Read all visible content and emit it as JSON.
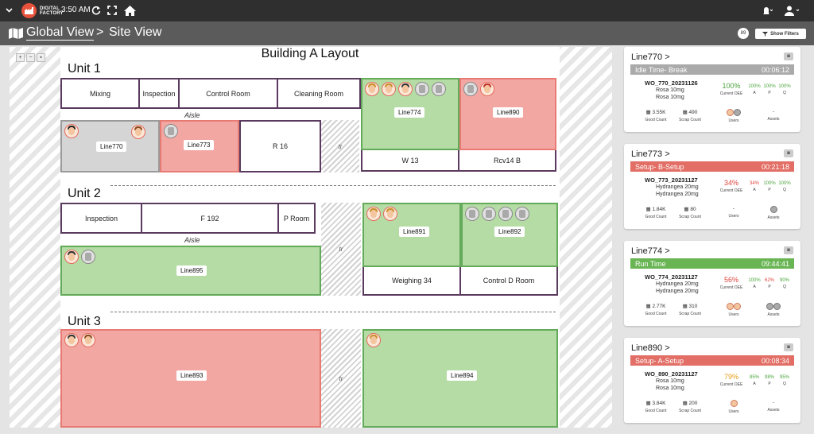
{
  "topbar": {
    "logo_line1": "DIGITAL",
    "logo_line2": "FACTORY",
    "time": "3:50 AM",
    "icons": [
      "chevron-down-icon",
      "refresh-icon",
      "expand-icon",
      "home-icon",
      "bell-icon",
      "user-icon"
    ]
  },
  "titlebar": {
    "crumb1": "Global View",
    "separator": ">",
    "crumb2": "Site View",
    "badge": "89",
    "filters": "Show Filters"
  },
  "layout": {
    "title": "Building A Layout",
    "units": [
      "Unit 1",
      "Unit 2",
      "Unit 3"
    ],
    "aisle": "Aisle",
    "tr": "tr",
    "rooms": {
      "mixing": "Mixing",
      "inspection1": "Inspection",
      "control_room": "Control Room",
      "cleaning_room": "Cleaning Room",
      "r16": "R 16",
      "w13": "W 13",
      "rcv14b": "Rcv14 B",
      "inspection2": "Inspection",
      "f192": "F 192",
      "p_room": "P Room",
      "weighing34": "Weighing 34",
      "control_d_room": "Control D Room"
    },
    "lines": {
      "l770": "Line770",
      "l773": "Line773",
      "l774": "Line774",
      "l890": "Line890",
      "l891": "Line891",
      "l892": "Line892",
      "l895": "Line895",
      "l893": "Line893",
      "l894": "Line894"
    }
  },
  "cards": [
    {
      "name": "Line770",
      "state": "Idle Time- Break",
      "timer": "00:06:12",
      "wo": "WO_770_20231126",
      "product1": "Rosa 10mg",
      "product2": "Rosa 10mg",
      "oee": "100%",
      "oee_label": "Current OEE",
      "a": "100%",
      "p": "100%",
      "q": "100%",
      "good": "3.55K",
      "scrap": "490",
      "assets": "-"
    },
    {
      "name": "Line773",
      "state": "Setup- B-Setup",
      "timer": "00:21:18",
      "wo": "WO_773_20231127",
      "product1": "Hydrangea 20mg",
      "product2": "Hydrangea 20mg",
      "oee": "34%",
      "oee_label": "Current OEE",
      "a": "34%",
      "p": "100%",
      "q": "100%",
      "good": "1.84K",
      "scrap": "80",
      "users": "-"
    },
    {
      "name": "Line774",
      "state": "Run Time",
      "timer": "09:44:41",
      "wo": "WO_774_20231127",
      "product1": "Hydrangea 20mg",
      "product2": "Hydrangea 20mg",
      "oee": "56%",
      "oee_label": "Current OEE",
      "a": "100%",
      "p": "62%",
      "q": "90%",
      "good": "2.77K",
      "scrap": "310"
    },
    {
      "name": "Line890",
      "state": "Setup- A-Setup",
      "timer": "00:08:34",
      "wo": "WO_890_20231127",
      "product1": "Rosa 10mg",
      "product2": "Rosa 10mg",
      "oee": "79%",
      "oee_label": "Current OEE",
      "a": "85%",
      "p": "98%",
      "q": "95%",
      "good": "3.84K",
      "scrap": "200",
      "assets": "-"
    }
  ],
  "labels": {
    "good_count": "Good Count",
    "scrap_count": "Scrap Count",
    "users": "Users",
    "assets": "Assets",
    "a": "A",
    "p": "P",
    "q": "Q",
    "chevron": ">"
  },
  "colors": {
    "idle": "#aaaaaa",
    "setup": "#e26e65",
    "run": "#69b553",
    "topbar": "#2f2f2f",
    "titlebar": "#5b5b5b"
  }
}
